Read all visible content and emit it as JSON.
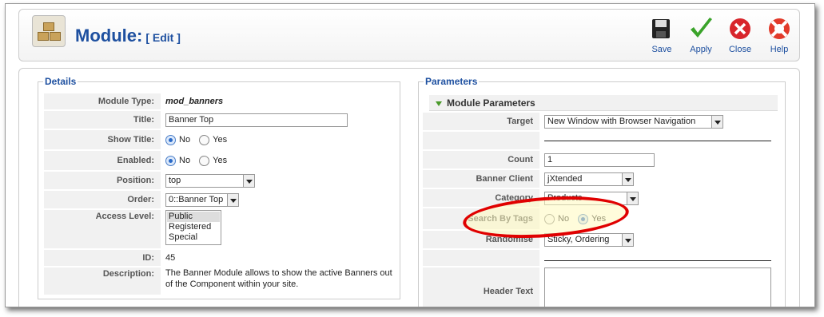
{
  "header": {
    "title": "Module:",
    "subtitle": "[ Edit ]"
  },
  "toolbar": {
    "save": "Save",
    "apply": "Apply",
    "close": "Close",
    "help": "Help"
  },
  "details": {
    "legend": "Details",
    "module_type_label": "Module Type:",
    "module_type_value": "mod_banners",
    "title_label": "Title:",
    "title_value": "Banner Top",
    "show_title_label": "Show Title:",
    "enabled_label": "Enabled:",
    "no": "No",
    "yes": "Yes",
    "position_label": "Position:",
    "position_value": "top",
    "order_label": "Order:",
    "order_value": "0::Banner Top",
    "access_label": "Access Level:",
    "access_options": [
      "Public",
      "Registered",
      "Special"
    ],
    "id_label": "ID:",
    "id_value": "45",
    "description_label": "Description:",
    "description_value": "The Banner Module allows to show the active Banners out of the Component within your site."
  },
  "parameters": {
    "legend": "Parameters",
    "section": "Module Parameters",
    "target_label": "Target",
    "target_value": "New Window with Browser Navigation",
    "count_label": "Count",
    "count_value": "1",
    "client_label": "Banner Client",
    "client_value": "jXtended",
    "category_label": "Category",
    "category_value": "Products",
    "search_tags_label": "Search By Tags",
    "no": "No",
    "yes": "Yes",
    "randomise_label": "Randomise",
    "randomise_value": "Sticky, Ordering",
    "header_text_label": "Header Text"
  },
  "colors": {
    "accent": "#1e50a0",
    "highlight": "#e00000"
  }
}
